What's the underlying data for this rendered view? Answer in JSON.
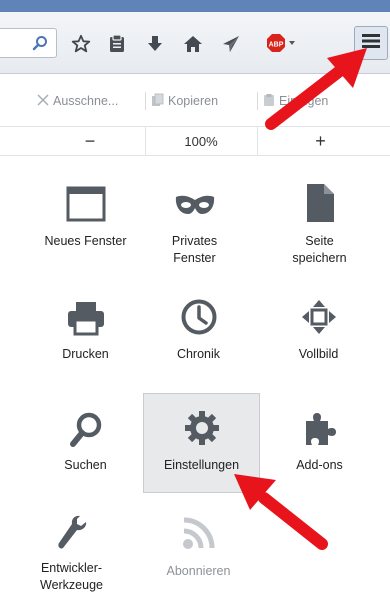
{
  "window": {
    "accent": "#5f84b8"
  },
  "toolbar": {
    "icons": [
      "search-icon",
      "star-icon",
      "reading-list-icon",
      "download-icon",
      "home-icon",
      "send-icon",
      "adblock-icon",
      "menu-icon"
    ],
    "adblock_badge": "ABP"
  },
  "edit": {
    "cut_label": "Ausschne...",
    "copy_label": "Kopieren",
    "paste_label": "Einfügen"
  },
  "zoom": {
    "minus_label": "−",
    "level": "100%",
    "plus_label": "+"
  },
  "menu_items": [
    {
      "id": "new-window",
      "label_lines": [
        "Neues Fenster"
      ],
      "icon": "window-icon"
    },
    {
      "id": "private-window",
      "label_lines": [
        "Privates",
        "Fenster"
      ],
      "icon": "mask-icon"
    },
    {
      "id": "save-page",
      "label_lines": [
        "Seite",
        "speichern"
      ],
      "icon": "page-icon"
    },
    {
      "id": "print",
      "label_lines": [
        "Drucken"
      ],
      "icon": "printer-icon"
    },
    {
      "id": "history",
      "label_lines": [
        "Chronik"
      ],
      "icon": "clock-icon"
    },
    {
      "id": "fullscreen",
      "label_lines": [
        "Vollbild"
      ],
      "icon": "fullscreen-icon"
    },
    {
      "id": "find",
      "label_lines": [
        "Suchen"
      ],
      "icon": "search-icon"
    },
    {
      "id": "settings",
      "label_lines": [
        "Einstellungen"
      ],
      "icon": "gear-icon",
      "highlighted": true
    },
    {
      "id": "addons",
      "label_lines": [
        "Add-ons"
      ],
      "icon": "puzzle-icon"
    },
    {
      "id": "developer",
      "label_lines": [
        "Entwickler-",
        "Werkzeuge"
      ],
      "icon": "wrench-icon"
    },
    {
      "id": "subscribe",
      "label_lines": [
        "Abonnieren"
      ],
      "icon": "rss-icon",
      "disabled": true
    }
  ],
  "annotations": {
    "arrow_color": "#e8141b"
  }
}
